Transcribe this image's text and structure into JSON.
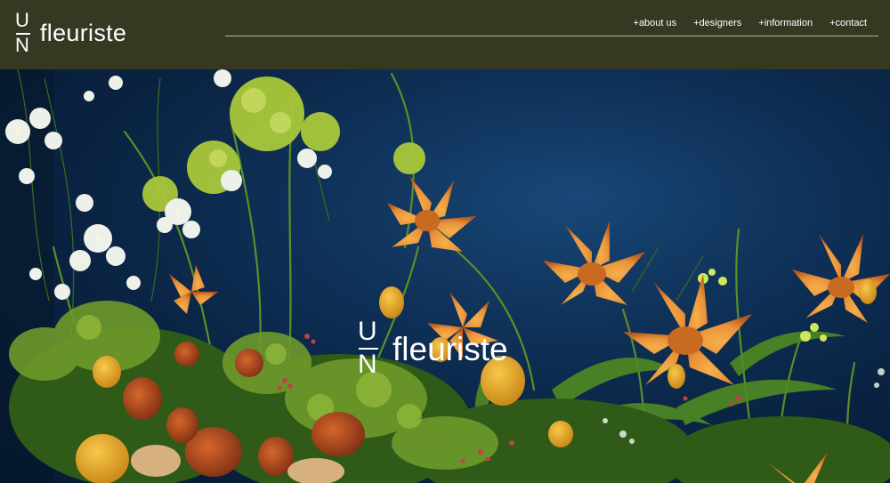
{
  "brand": {
    "mark_top": "U",
    "mark_bottom": "N",
    "name": "fleuriste"
  },
  "nav": {
    "items": [
      "+about us",
      "+designers",
      "+information",
      "+contact"
    ]
  },
  "hero": {
    "mark_top": "U",
    "mark_bottom": "N",
    "name": "fleuriste"
  },
  "colors": {
    "header_bg": "#373822",
    "backdrop": "#0e2f55",
    "petal": "#e8913a",
    "foliage": "#6e9a2a"
  }
}
